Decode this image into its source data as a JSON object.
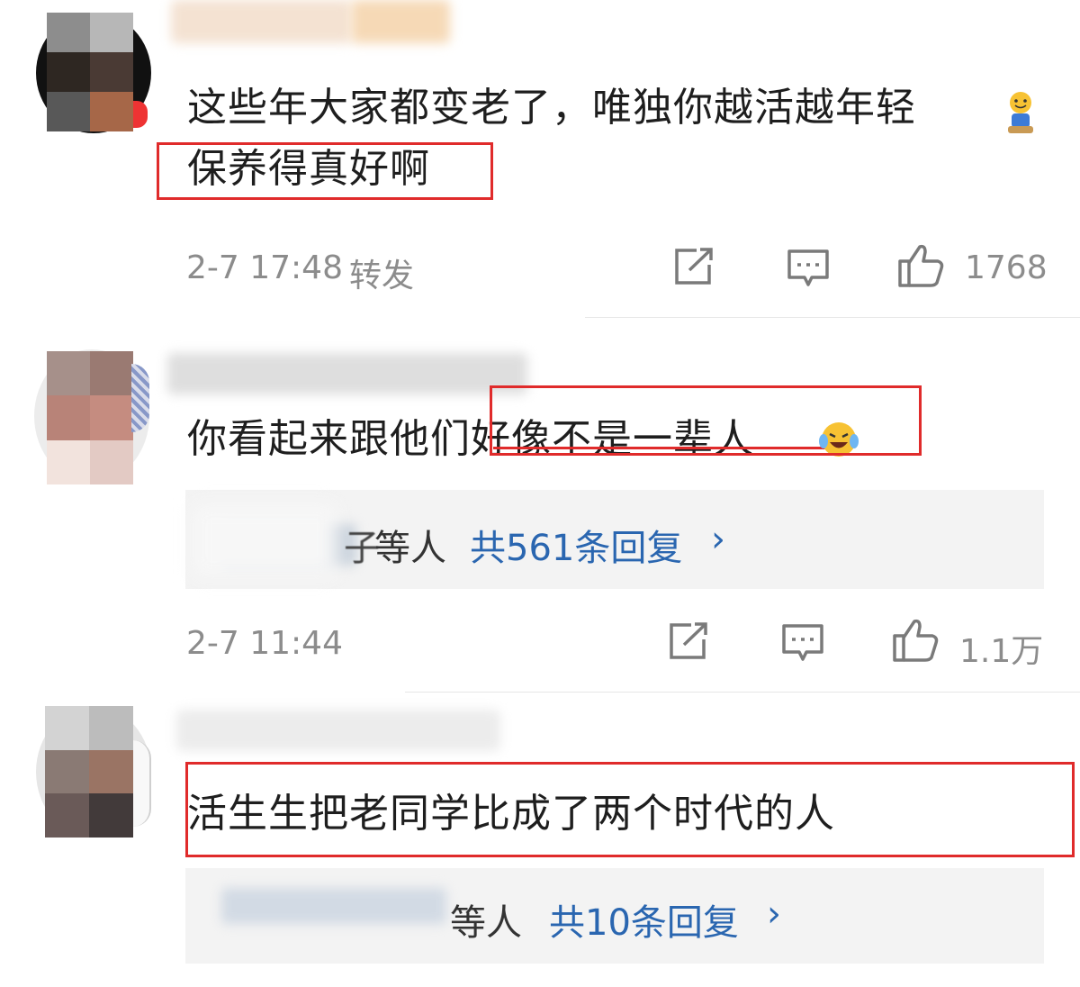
{
  "comments": [
    {
      "text_line1": "这些年大家都变老了，唯独你越活越年轻",
      "text_line2": "保养得真好啊",
      "timestamp": "2-7 17:48",
      "forward_label": "转发",
      "likes": "1768",
      "emoji_icon": "smiley-emoji-icon"
    },
    {
      "text": "你看起来跟他们好像不是一辈人",
      "replies_suffix": "等人",
      "replies_prefix_visible": "子",
      "replies_link": "共561条回复",
      "replies_chevron": "›",
      "timestamp": "2-7 11:44",
      "likes": "1.1万",
      "emoji_icon": "laugh-cry-emoji-icon"
    },
    {
      "text": "活生生把老同学比成了两个时代的人",
      "replies_suffix": "等人",
      "replies_link": "共10条回复",
      "replies_chevron": "›"
    }
  ],
  "colors": {
    "highlight_border": "#e02b2b",
    "link": "#2a66b0",
    "meta_text": "#8c8c8c",
    "reply_panel_bg": "#f3f3f3"
  },
  "icons": [
    "share-icon",
    "comment-icon",
    "thumbs-up-icon"
  ]
}
